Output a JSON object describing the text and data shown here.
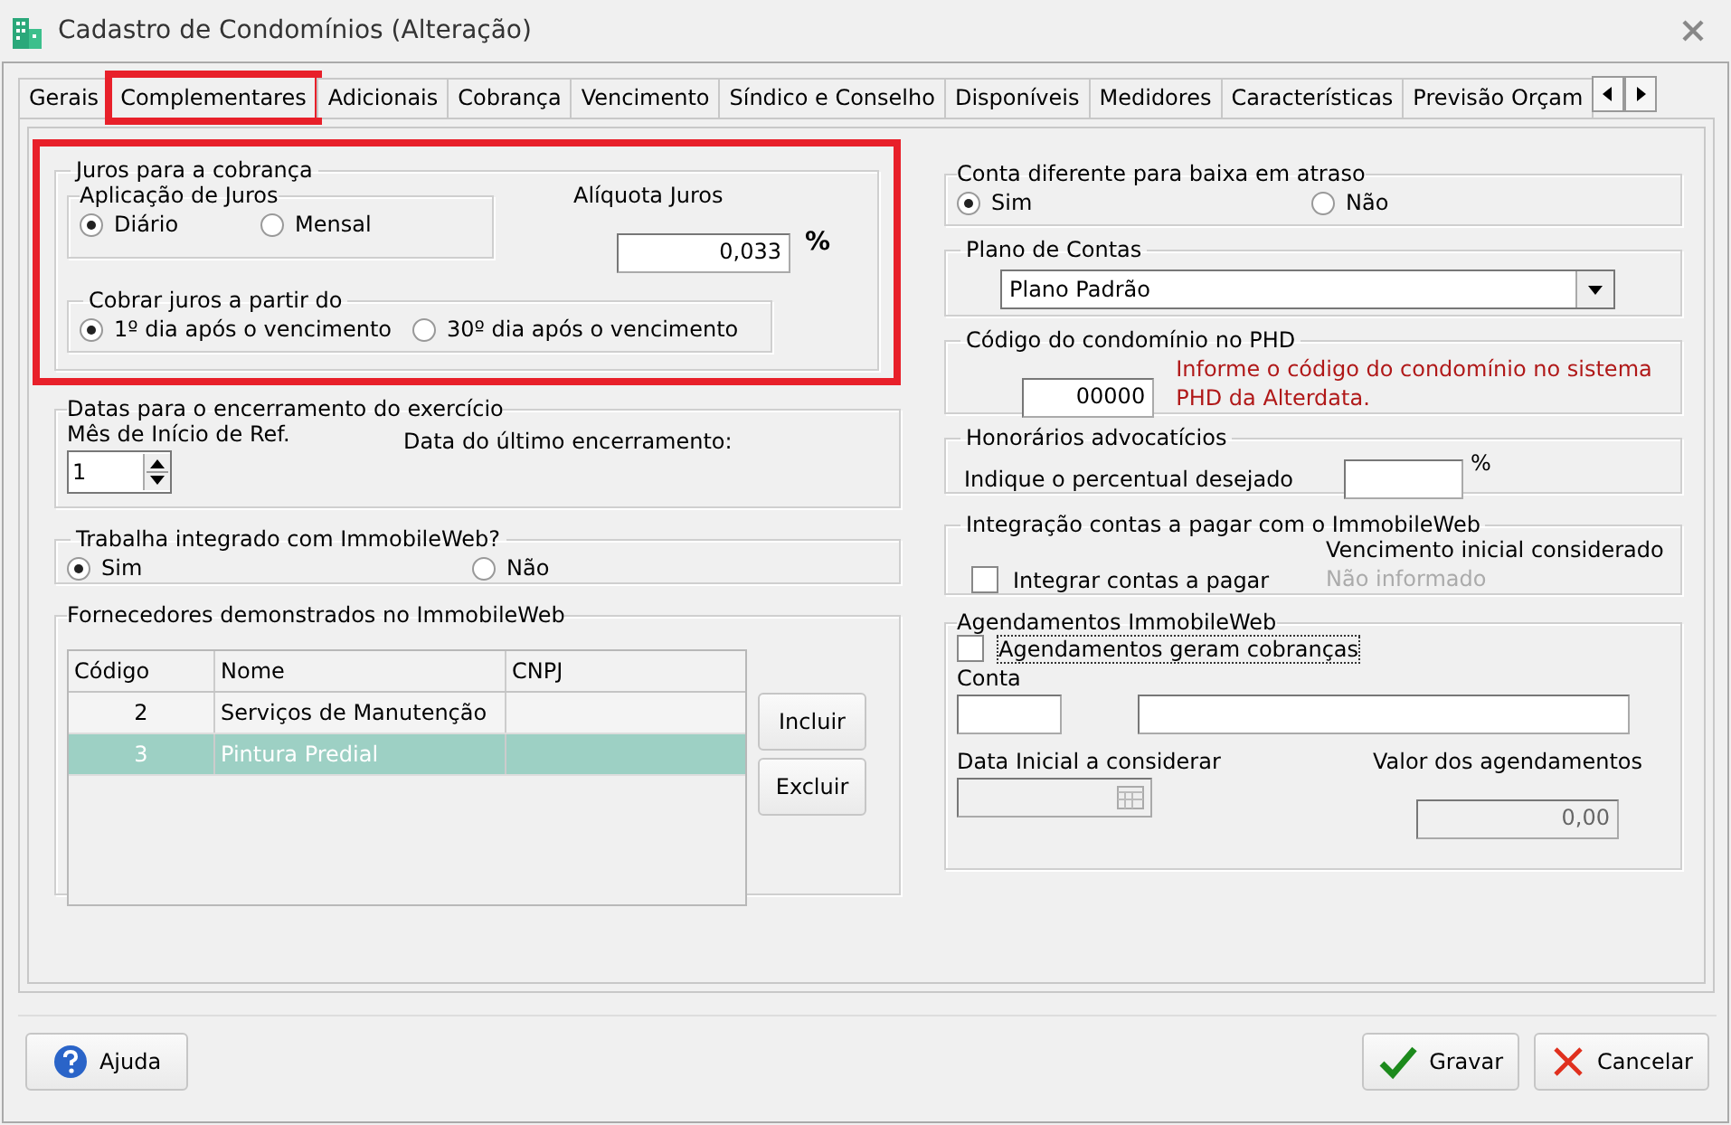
{
  "window": {
    "title": "Cadastro de Condomínios (Alteração)"
  },
  "tabs": [
    {
      "label": "Gerais",
      "selected": false,
      "highlighted": false
    },
    {
      "label": "Complementares",
      "selected": true,
      "highlighted": true
    },
    {
      "label": "Adicionais",
      "selected": false,
      "highlighted": false
    },
    {
      "label": "Cobrança",
      "selected": false,
      "highlighted": false
    },
    {
      "label": "Vencimento",
      "selected": false,
      "highlighted": false
    },
    {
      "label": "Síndico e Conselho",
      "selected": false,
      "highlighted": false
    },
    {
      "label": "Disponíveis",
      "selected": false,
      "highlighted": false
    },
    {
      "label": "Medidores",
      "selected": false,
      "highlighted": false
    },
    {
      "label": "Características",
      "selected": false,
      "highlighted": false
    },
    {
      "label": "Previsão Orçam",
      "selected": false,
      "highlighted": false
    }
  ],
  "juros": {
    "title": "Juros para a cobrança",
    "highlighted": true,
    "aplicacao": {
      "title": "Aplicação de Juros",
      "options": [
        {
          "label": "Diário",
          "selected": true
        },
        {
          "label": "Mensal",
          "selected": false
        }
      ]
    },
    "aliquota": {
      "label": "Alíquota Juros",
      "value": "0,033",
      "unit": "%"
    },
    "cobrar": {
      "title": "Cobrar juros a partir do",
      "options": [
        {
          "label": "1º dia após o vencimento",
          "selected": true
        },
        {
          "label": "30º dia após o vencimento",
          "selected": false
        }
      ]
    }
  },
  "encerramento": {
    "title": "Datas para o encerramento do exercício",
    "mes_label": "Mês de Início de Ref.",
    "mes_value": "1",
    "ultimo_label": "Data do último encerramento:"
  },
  "immobile": {
    "title": "Trabalha integrado com ImmobileWeb?",
    "options": [
      {
        "label": "Sim",
        "selected": true
      },
      {
        "label": "Não",
        "selected": false
      }
    ]
  },
  "fornecedores": {
    "title": "Fornecedores demonstrados no ImmobileWeb",
    "columns": [
      "Código",
      "Nome",
      "CNPJ"
    ],
    "rows": [
      {
        "codigo": "2",
        "nome": "Serviços de Manutenção",
        "selected": false
      },
      {
        "codigo": "3",
        "nome": "Pintura Predial",
        "selected": true
      }
    ],
    "buttons": [
      "Incluir",
      "Excluir"
    ]
  },
  "conta_diferente": {
    "title": "Conta diferente para baixa em atraso",
    "options": [
      {
        "label": "Sim",
        "selected": true
      },
      {
        "label": "Não",
        "selected": false
      }
    ]
  },
  "plano": {
    "title": "Plano de Contas",
    "value": "Plano Padrão"
  },
  "phd": {
    "title": "Código do condomínio no PHD",
    "value": "00000",
    "hint": "Informe o código do condomínio no sistema PHD da Alterdata."
  },
  "honorarios": {
    "title": "Honorários advocatícios",
    "label": "Indique o percentual desejado",
    "unit": "%"
  },
  "integracao": {
    "title": "Integração contas a pagar com o ImmobileWeb",
    "checkbox": {
      "label": "Integrar contas a pagar",
      "checked": false
    },
    "venc_label": "Vencimento inicial considerado",
    "venc_value": "Não informado"
  },
  "agendamentos": {
    "title": "Agendamentos ImmobileWeb",
    "checkbox": {
      "label": "Agendamentos geram cobranças",
      "checked": false,
      "focused": true
    },
    "conta_label": "Conta",
    "data_label": "Data Inicial a considerar",
    "valor_label": "Valor dos agendamentos",
    "valor_value": "0,00"
  },
  "footer": {
    "help": "Ajuda",
    "save": "Gravar",
    "cancel": "Cancelar"
  }
}
